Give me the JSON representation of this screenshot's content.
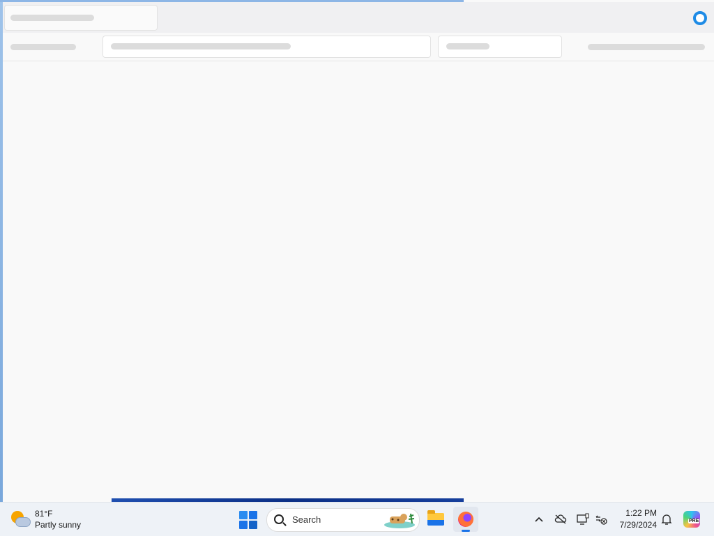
{
  "taskbar": {
    "weather": {
      "temp": "81°F",
      "condition": "Partly sunny",
      "icon": "partly-sunny-icon"
    },
    "search": {
      "label": "Search"
    },
    "clock": {
      "time": "1:22 PM",
      "date": "7/29/2024"
    },
    "copilot_badge": "PRE",
    "colors": {
      "accent": "#1a73e8",
      "taskbar_bg": "#eef2f7"
    }
  },
  "app": {
    "state": "loading",
    "loading_indicator_color": "#1e8be6"
  }
}
